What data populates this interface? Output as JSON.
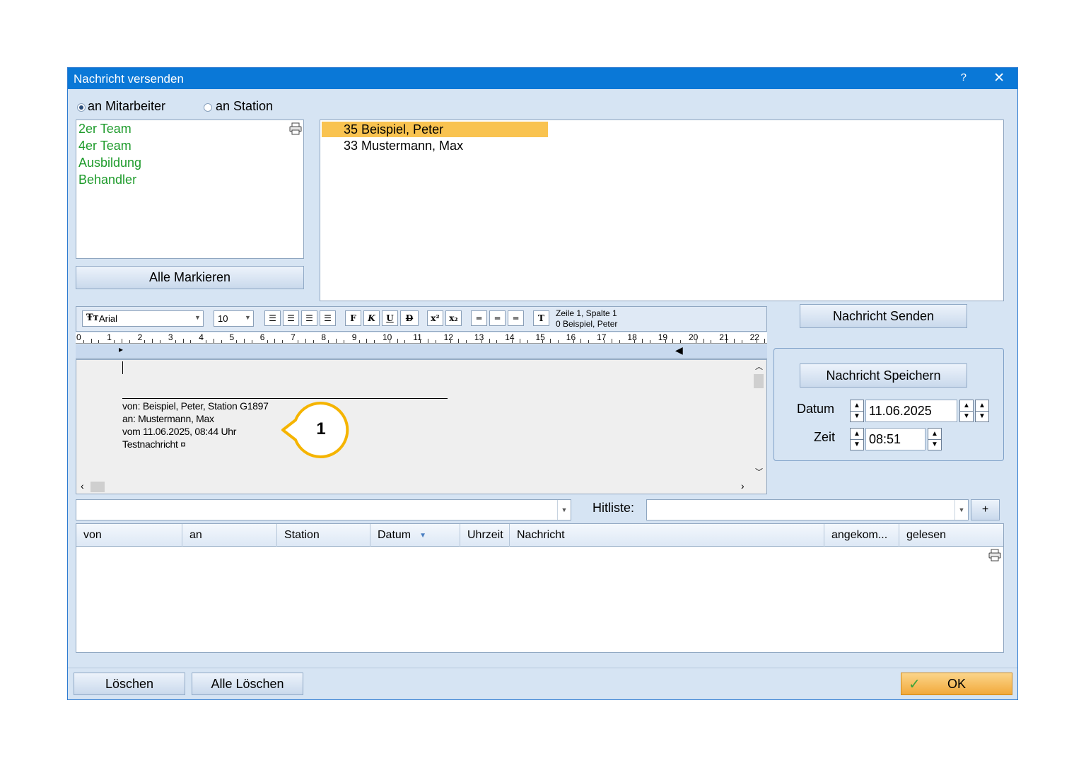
{
  "window": {
    "title": "Nachricht versenden",
    "help": "?",
    "close": "✕"
  },
  "recipient_mode": {
    "option1": "an Mitarbeiter",
    "option2": "an Station",
    "selected": "an Mitarbeiter"
  },
  "groups": [
    "2er Team",
    "4er Team",
    "Ausbildung",
    "Behandler"
  ],
  "employees": [
    {
      "label": "35 Beispiel, Peter",
      "selected": true
    },
    {
      "label": "33 Mustermann, Max",
      "selected": false
    }
  ],
  "buttons": {
    "mark_all": "Alle Markieren",
    "send": "Nachricht Senden",
    "save": "Nachricht Speichern",
    "delete": "Löschen",
    "delete_all": "Alle Löschen",
    "ok": "OK",
    "plus": "+"
  },
  "toolbar": {
    "font": "Arial",
    "size": "10",
    "bold": "F",
    "italic": "K",
    "underline": "U",
    "strike": "D",
    "status_line1": "Zeile 1, Spalte 1",
    "status_line2": "0 Beispiel, Peter"
  },
  "ruler": [
    "0",
    "1",
    "2",
    "3",
    "4",
    "5",
    "6",
    "7",
    "8",
    "9",
    "10",
    "11",
    "12",
    "13",
    "14",
    "15",
    "16",
    "17",
    "18",
    "19",
    "20",
    "21",
    "22"
  ],
  "document": {
    "lines": [
      "von: Beispiel, Peter, Station G1897",
      "an: Mustermann, Max",
      "vom 11.06.2025, 08:44 Uhr",
      "Testnachricht ¤"
    ],
    "callout": "1"
  },
  "schedule": {
    "date_label": "Datum",
    "date_value": "11.06.2025",
    "time_label": "Zeit",
    "time_value": "08:51"
  },
  "filter": {
    "value": "",
    "hitlist_label": "Hitliste:",
    "hitlist_value": ""
  },
  "table": {
    "columns": [
      "von",
      "an",
      "Station",
      "Datum",
      "Uhrzeit",
      "Nachricht",
      "angekom...",
      "gelesen"
    ],
    "sort_column": "Datum",
    "rows": []
  },
  "colors": {
    "title_bar": "#0a78d7",
    "selection": "#f9c350",
    "group_text": "#1e9b2b",
    "callout": "#f5b400"
  }
}
